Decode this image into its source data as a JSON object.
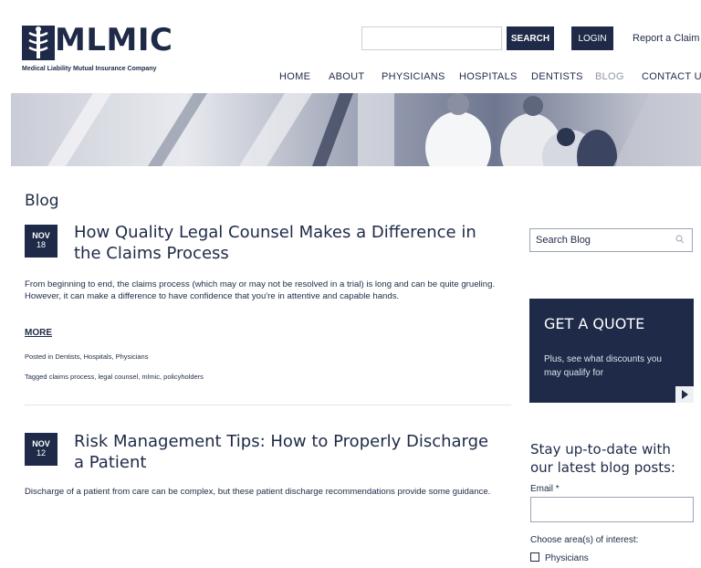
{
  "header": {
    "logo_text": "MLMIC",
    "logo_tagline": "Medical Liability Mutual Insurance Company",
    "search_button": "SEARCH",
    "search_value": "",
    "login_button": "LOGIN",
    "report_claim": "Report a Claim"
  },
  "nav": {
    "items": [
      {
        "label": "HOME"
      },
      {
        "label": "ABOUT"
      },
      {
        "label": "PHYSICIANS"
      },
      {
        "label": "HOSPITALS"
      },
      {
        "label": "DENTISTS"
      },
      {
        "label": "BLOG"
      },
      {
        "label": "CONTACT US"
      }
    ],
    "active": "BLOG"
  },
  "main": {
    "page_title": "Blog",
    "posts": [
      {
        "month": "NOV",
        "day": "18",
        "title": "How Quality Legal Counsel Makes a Difference in the Claims Process",
        "excerpt": "From beginning to end, the claims process (which may or may not be resolved in a trial) is long and can be quite grueling. However, it can make a difference to have confidence that you're in attentive and capable hands.",
        "more": "MORE",
        "posted_in": "Posted in Dentists, Hospitals, Physicians",
        "tagged": "Tagged claims process, legal counsel, mlmic, policyholders"
      },
      {
        "month": "NOV",
        "day": "12",
        "title": "Risk Management Tips: How to Properly Discharge a Patient",
        "excerpt": "Discharge of a patient from care can be complex, but these patient discharge recommendations provide some guidance."
      }
    ]
  },
  "sidebar": {
    "search_placeholder": "Search Blog",
    "quote_title": "GET A QUOTE",
    "quote_sub": "Plus, see what discounts you may qualify for",
    "subscribe_title": "Stay up-to-date with our latest blog posts:",
    "email_label": "Email *",
    "email_value": "",
    "choose_label": "Choose area(s) of interest:",
    "checkbox_physicians": "Physicians"
  },
  "colors": {
    "brand_navy": "#1e2a47",
    "active_nav": "#8f96a8"
  }
}
